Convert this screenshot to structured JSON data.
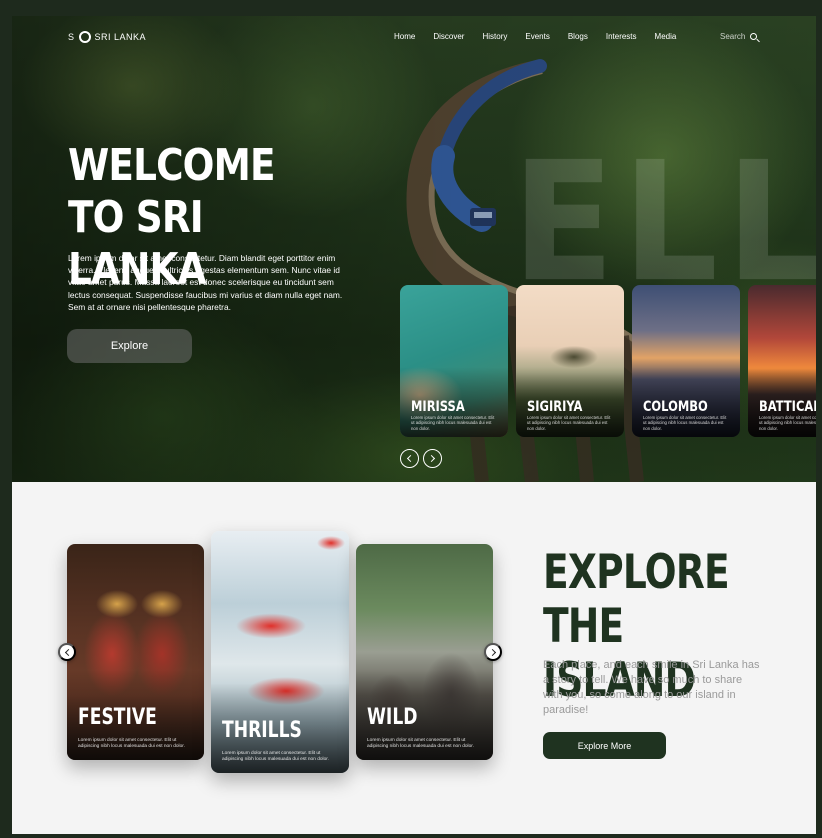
{
  "nav": {
    "logo_prefix": "S",
    "logo_suffix": "SRI LANKA",
    "links": [
      "Home",
      "Discover",
      "History",
      "Events",
      "Blogs",
      "Interests",
      "Media"
    ],
    "search_label": "Search"
  },
  "hero": {
    "title_line1": "WELCOME",
    "title_line2": "TO SRI LANKA",
    "text": "Lorem ipsum dolor sit amet consectetur. Diam blandit eget porttitor enim viverra. Eleifend augue id ultricies egestas elementum sem. Nunc vitae id vitae amet purus. Massa laoreet est donec scelerisque eu tincidunt sem lectus consequat. Suspendisse faucibus mi varius et diam nulla eget nam. Sem at at ornare nisi pellentesque pharetra.",
    "button": "Explore",
    "background_word": "ELLA",
    "destinations": [
      {
        "name": "MIRISSA",
        "desc": "Lorem ipsum dolor sit amet consectetur. Elit ut adipiscing nibh locus malesuada dui est non dolor."
      },
      {
        "name": "SIGIRIYA",
        "desc": "Lorem ipsum dolor sit amet consectetur. Elit ut adipiscing nibh locus malesuada dui est non dolor."
      },
      {
        "name": "COLOMBO",
        "desc": "Lorem ipsum dolor sit amet consectetur. Elit ut adipiscing nibh locus malesuada dui est non dolor."
      },
      {
        "name": "BATTICALO",
        "desc": "Lorem ipsum dolor sit amet consectetur. Elit ut adipiscing nibh locus malesuada dui est non dolor."
      }
    ]
  },
  "explore": {
    "title_line1": "EXPLORE",
    "title_line2": "THE ISLAND",
    "text": "Each place, and each smile in Sri Lanka has a story to tell. We have so much to share with you, so come along to our island in paradise!",
    "button": "Explore More",
    "categories": [
      {
        "name": "FESTIVE",
        "desc": "Lorem ipsum dolor sit amet consectetur. Elit ut adipiscing nibh locus malesuada dui est non dolor."
      },
      {
        "name": "THRILLS",
        "desc": "Lorem ipsum dolor sit amet consectetur. Elit ut adipiscing nibh locus malesuada dui est non dolor."
      },
      {
        "name": "WILD",
        "desc": "Lorem ipsum dolor sit amet consectetur. Elit ut adipiscing nibh locus malesuada dui est non dolor."
      }
    ]
  },
  "colors": {
    "frame": "#1e2a1d",
    "brand_dark_green": "#1f3320",
    "section_bg": "#f4f4f4",
    "muted_text": "#9a9a9a"
  }
}
